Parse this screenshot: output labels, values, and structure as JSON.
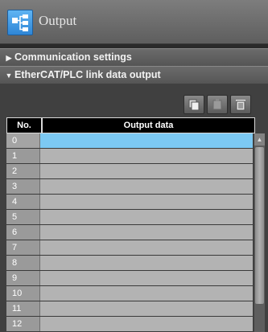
{
  "header": {
    "title": "Output",
    "icon": "network-icon",
    "accent": "#2f86d6"
  },
  "sections": [
    {
      "label": "Communication settings",
      "expanded": false
    },
    {
      "label": "EtherCAT/PLC link data output",
      "expanded": true
    }
  ],
  "toolbar": {
    "icons": [
      "copy-icon",
      "paste-icon",
      "delete-icon"
    ]
  },
  "table": {
    "columns": [
      "No.",
      "Output data"
    ],
    "rows": [
      "0",
      "1",
      "2",
      "3",
      "4",
      "5",
      "6",
      "7",
      "8",
      "9",
      "10",
      "11",
      "12"
    ],
    "selected_row": "0",
    "selected_color": "#7cc9f3"
  }
}
